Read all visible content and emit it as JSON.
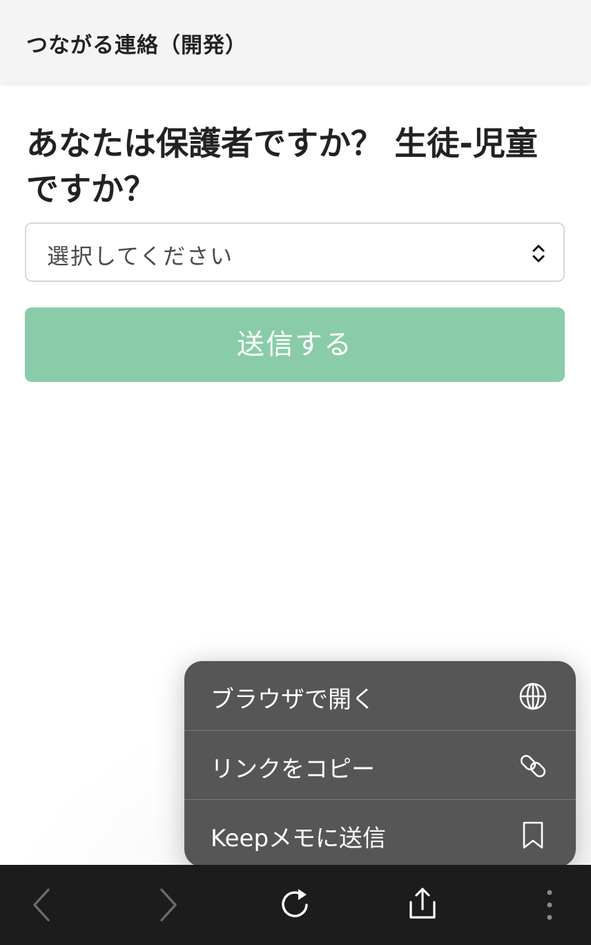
{
  "header": {
    "title": "つながる連絡（開発）"
  },
  "main": {
    "question": "あなたは保護者ですか？ 生徒-児童ですか？",
    "select": {
      "value": "選択してください"
    },
    "submit_label": "送信する"
  },
  "context_menu": {
    "items": [
      {
        "label": "ブラウザで開く",
        "icon": "globe-icon"
      },
      {
        "label": "リンクをコピー",
        "icon": "link-icon"
      },
      {
        "label": "Keepメモに送信",
        "icon": "bookmark-icon"
      }
    ]
  },
  "browser_toolbar": {
    "buttons": [
      "back-icon",
      "forward-icon",
      "reload-icon",
      "share-icon",
      "more-icon"
    ]
  },
  "colors": {
    "accent": "#8acca9",
    "header_bg": "#f4f4f4",
    "menu_bg": "#565656",
    "toolbar_bg": "#1c1c1c"
  }
}
